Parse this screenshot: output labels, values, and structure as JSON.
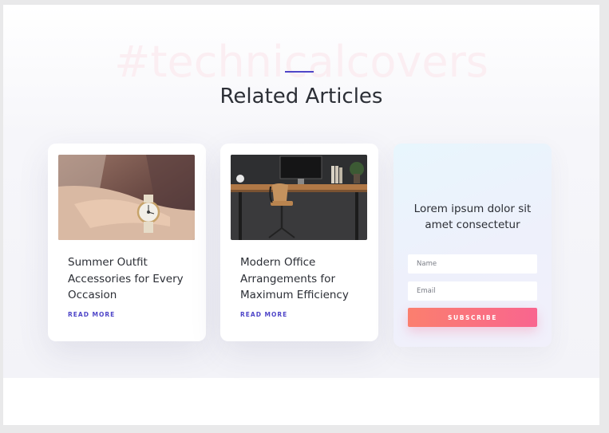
{
  "section": {
    "watermark": "#technicalcovers",
    "title": "Related Articles"
  },
  "articles": [
    {
      "title_lines": [
        "Summer Outfit",
        "Accessories for Every",
        "Occasion"
      ],
      "read_more": "READ MORE",
      "image": "wristwatch-photo"
    },
    {
      "title_lines": [
        "Modern Office",
        "Arrangements for",
        "Maximum Efficiency"
      ],
      "read_more": "READ MORE",
      "image": "office-desk-photo"
    }
  ],
  "subscribe_box": {
    "heading_lines": [
      "Lorem ipsum dolor sit",
      "amet consectetur"
    ],
    "name_placeholder": "Name",
    "email_placeholder": "Email",
    "button_label": "SUBSCRIBE"
  },
  "colors": {
    "accent": "#4f46c8",
    "button_gradient_start": "#fb7f6e",
    "button_gradient_end": "#f9658f"
  }
}
